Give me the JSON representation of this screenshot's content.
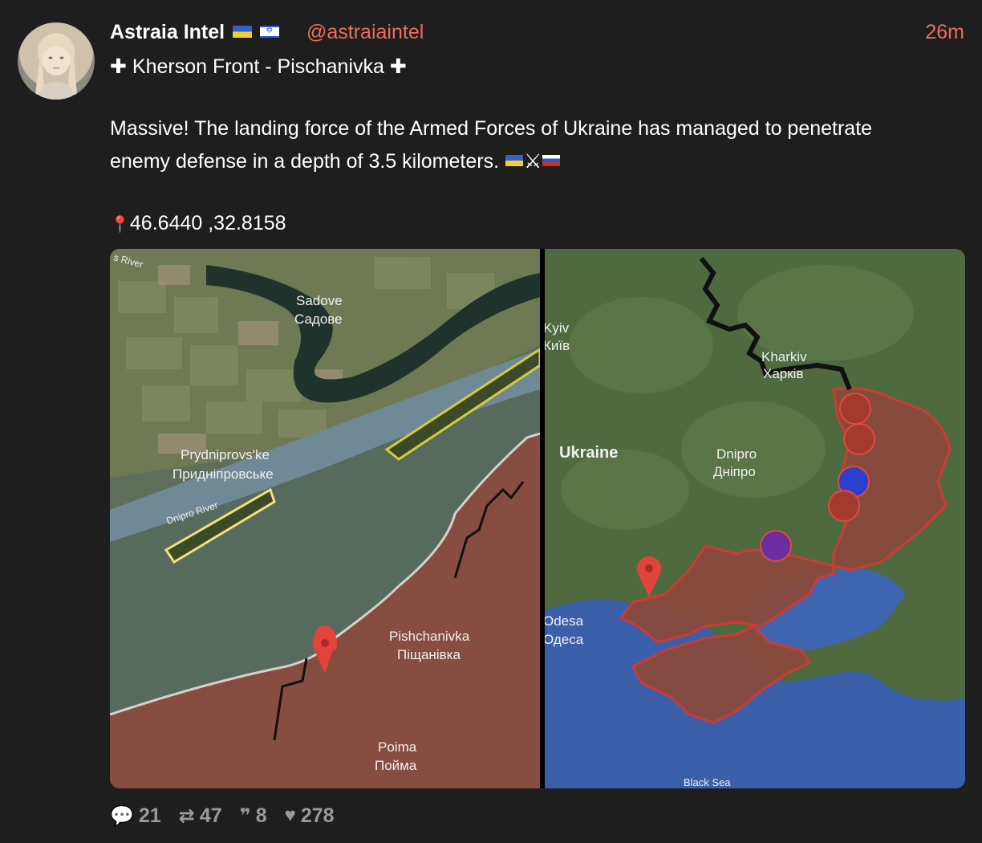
{
  "post": {
    "author": "Astraia Intel",
    "handle": "@astraiaintel",
    "time": "26m",
    "title": "✚ Kherson Front - Pischanivka ✚",
    "body_line1": "Massive! The landing force of the Armed Forces of Ukraine has managed to penetrate",
    "body_line2": "enemy defense in a depth of 3.5 kilometers.",
    "coordinates": "46.6440 ,32.8158"
  },
  "map_left": {
    "river_top": "s River",
    "sadove_en": "Sadove",
    "sadove_uk": "Садове",
    "prydniprovske_en": "Prydniprovs'ke",
    "prydniprovske_uk": "Придніпровське",
    "dnipro_river": "Dnipro River",
    "pishchanivka_en": "Pishchanivka",
    "pishchanivka_uk": "Піщанівка",
    "poima_en": "Poima",
    "poima_uk": "Пойма"
  },
  "map_right": {
    "kyiv_en": "Kyiv",
    "kyiv_uk": "Київ",
    "kharkiv_en": "Kharkiv",
    "kharkiv_uk": "Харків",
    "ukraine": "Ukraine",
    "dnipro_en": "Dnipro",
    "dnipro_uk": "Дніпро",
    "odesa_en": "Odesa",
    "odesa_uk": "Одеса",
    "black_sea": "Black Sea"
  },
  "stats": {
    "replies": "21",
    "reposts": "47",
    "quotes": "8",
    "likes": "278"
  },
  "colors": {
    "background": "#1e1e1e",
    "accent": "#ef6a5f",
    "muted": "#9a9a9a"
  }
}
